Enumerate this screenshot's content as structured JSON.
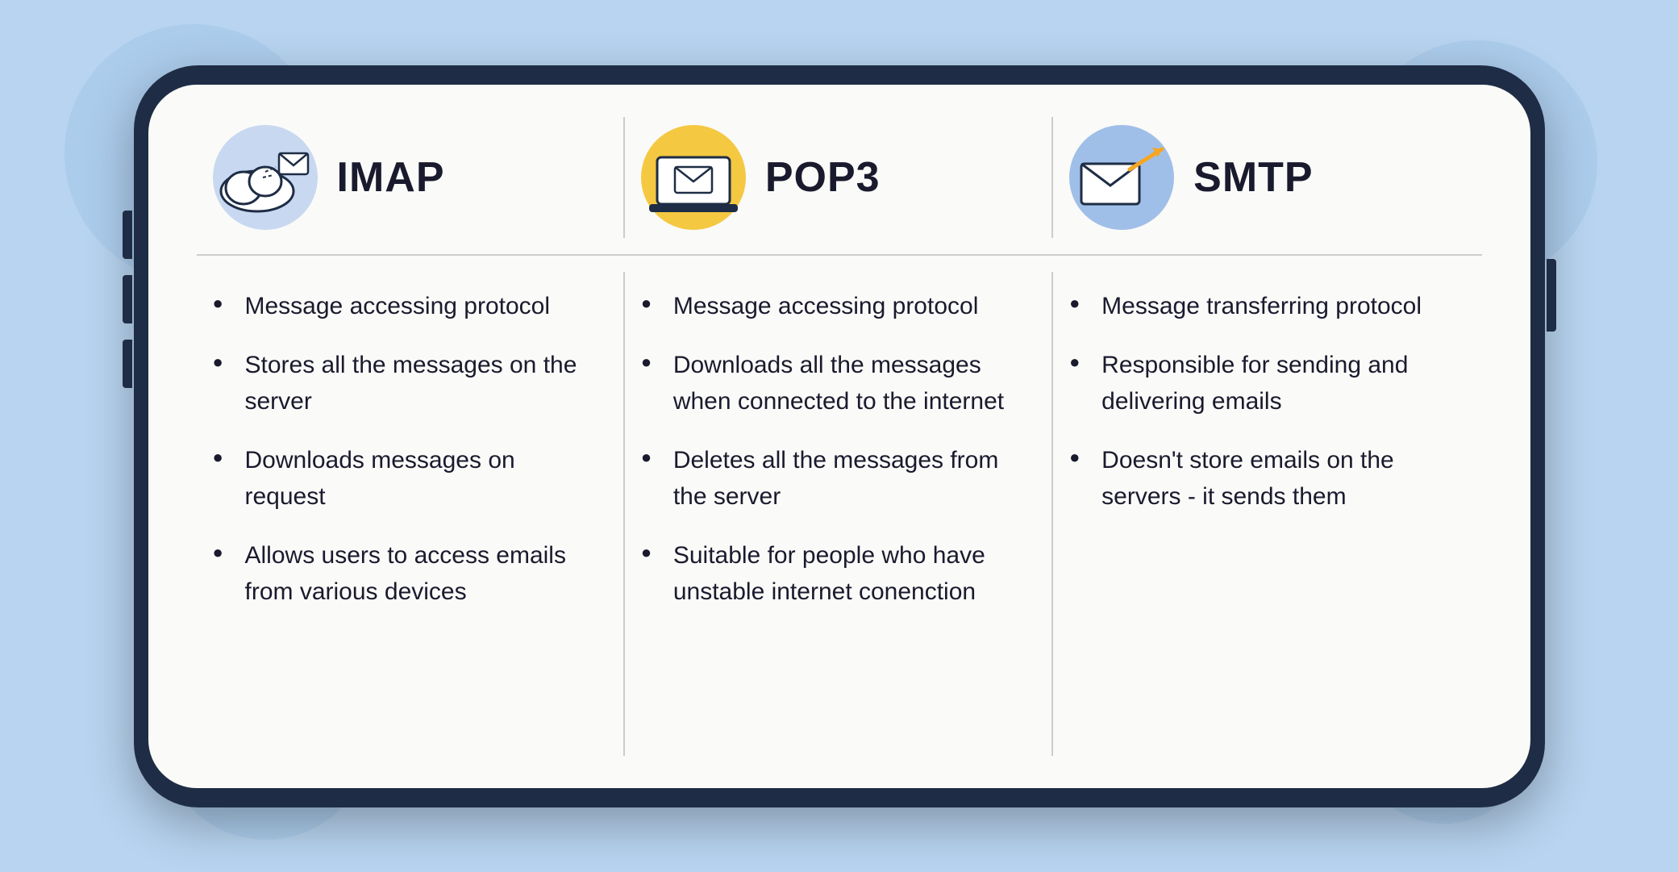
{
  "background": {
    "color": "#b8d4f0"
  },
  "columns": [
    {
      "id": "imap",
      "title": "IMAP",
      "icon_type": "cloud-email",
      "icon_bg": "#c8d8f0",
      "bullets": [
        "Message accessing protocol",
        "Stores all the messages on the server",
        "Downloads messages on request",
        "Allows users to access emails from various devices"
      ]
    },
    {
      "id": "pop3",
      "title": "POP3",
      "icon_type": "laptop-email",
      "icon_bg": "#f5c842",
      "bullets": [
        "Message accessing protocol",
        "Downloads all the messages when connected to the internet",
        "Deletes all the messages from the server",
        "Suitable for people who have unstable internet conenction"
      ]
    },
    {
      "id": "smtp",
      "title": "SMTP",
      "icon_type": "arrow-email",
      "icon_bg": "#a0bfe8",
      "bullets": [
        "Message transferring protocol",
        "Responsible for sending and delivering emails",
        "Doesn't store emails on the servers - it sends them"
      ]
    }
  ]
}
